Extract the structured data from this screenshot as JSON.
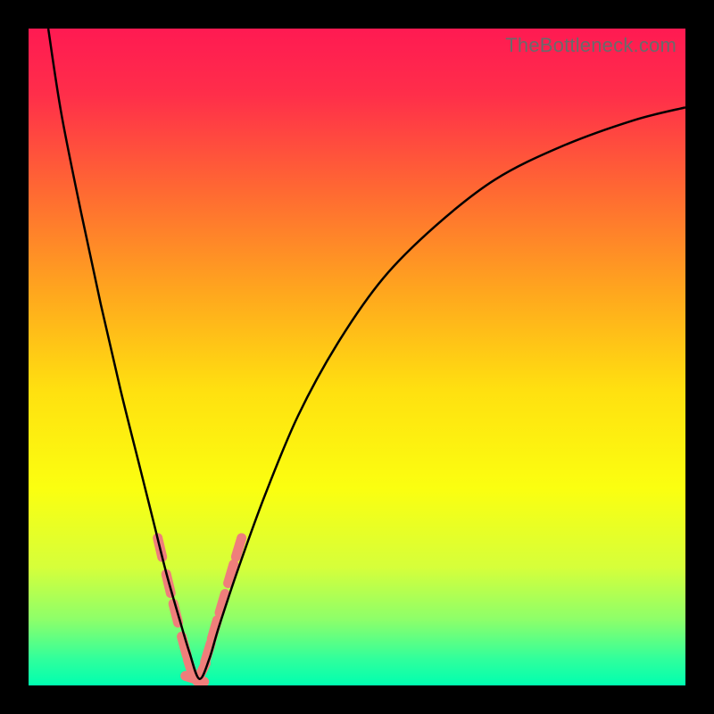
{
  "watermark": "TheBottleneck.com",
  "chart_data": {
    "type": "line",
    "title": "",
    "xlabel": "",
    "ylabel": "",
    "xlim": [
      0,
      100
    ],
    "ylim": [
      0,
      100
    ],
    "grid": false,
    "legend": false,
    "series": [
      {
        "name": "bottleneck-curve",
        "x": [
          3,
          5,
          8,
          11,
          14,
          17,
          19,
          21,
          23,
          24.5,
          26,
          27.5,
          29,
          32,
          36,
          41,
          47,
          54,
          62,
          71,
          81,
          92,
          100
        ],
        "y": [
          100,
          87,
          72,
          58,
          45,
          33,
          25,
          17,
          10,
          5,
          1,
          4,
          9,
          18,
          29,
          41,
          52,
          62,
          70,
          77,
          82,
          86,
          88
        ],
        "color": "#000000",
        "width": 2.5
      }
    ],
    "markers": [
      {
        "name": "highlight-beads",
        "x": [
          20.0,
          21.3,
          22.4,
          23.7,
          24.7,
          25.3,
          26.3,
          27.3,
          28.3,
          29.5,
          30.8,
          32.0
        ],
        "y": [
          21.0,
          15.5,
          11.0,
          6.0,
          2.5,
          1.0,
          2.0,
          5.0,
          8.5,
          12.5,
          17.0,
          21.0
        ],
        "color": "#ef7e7b",
        "size": 11
      }
    ],
    "background_gradient": {
      "stops": [
        {
          "offset": 0.0,
          "color": "#ff1a52"
        },
        {
          "offset": 0.1,
          "color": "#ff2e4a"
        },
        {
          "offset": 0.25,
          "color": "#ff6a32"
        },
        {
          "offset": 0.4,
          "color": "#ffa61e"
        },
        {
          "offset": 0.55,
          "color": "#ffe010"
        },
        {
          "offset": 0.7,
          "color": "#fbff10"
        },
        {
          "offset": 0.82,
          "color": "#d6ff3a"
        },
        {
          "offset": 0.9,
          "color": "#8dff6a"
        },
        {
          "offset": 0.96,
          "color": "#30ff9c"
        },
        {
          "offset": 1.0,
          "color": "#00ffb0"
        }
      ]
    }
  }
}
